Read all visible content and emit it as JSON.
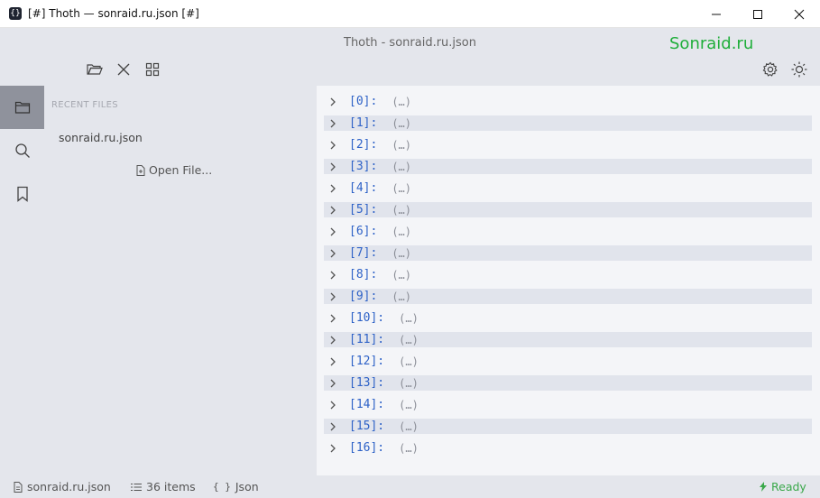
{
  "window": {
    "app_icon_glyph": "{}",
    "title": "[#] Thoth — sonraid.ru.json [#]",
    "controls": [
      "minimize-icon",
      "maximize-icon",
      "close-icon"
    ]
  },
  "header": {
    "title": "Thoth - sonraid.ru.json",
    "watermark": "Sonraid.ru",
    "left_icons": [
      "folder-open-icon",
      "close-icon",
      "grid-icon"
    ],
    "right_icons": [
      "gear-icon",
      "sun-icon"
    ]
  },
  "rail": {
    "items": [
      {
        "name": "files",
        "icon": "folder-icon",
        "active": true
      },
      {
        "name": "search",
        "icon": "search-icon",
        "active": false
      },
      {
        "name": "bookmarks",
        "icon": "bookmark-icon",
        "active": false
      }
    ]
  },
  "panel": {
    "recent_label": "RECENT FILES",
    "recent_file": "sonraid.ru.json",
    "open_file_label": "Open File..."
  },
  "tree": {
    "placeholder": "(…)",
    "rows": [
      "[0]:",
      "[1]:",
      "[2]:",
      "[3]:",
      "[4]:",
      "[5]:",
      "[6]:",
      "[7]:",
      "[8]:",
      "[9]:",
      "[10]:",
      "[11]:",
      "[12]:",
      "[13]:",
      "[14]:",
      "[15]:",
      "[16]:"
    ]
  },
  "status": {
    "file": "sonraid.ru.json",
    "items": "36 items",
    "format_glyph": "{ }",
    "format": "Json",
    "ready": "Ready"
  },
  "colors": {
    "accent": "#2e62c7",
    "watermark": "#1fae3a",
    "ready": "#3aa84a",
    "chrome": "#e4e6ec",
    "rail_active": "#8f929c"
  }
}
